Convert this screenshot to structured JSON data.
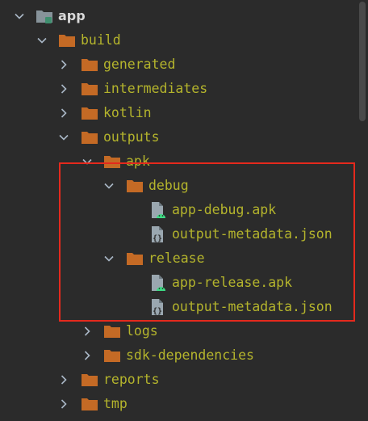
{
  "tree": {
    "root": {
      "label": "app",
      "icon": "module-folder-icon"
    },
    "build": {
      "label": "build"
    },
    "generated": {
      "label": "generated"
    },
    "intermediates": {
      "label": "intermediates"
    },
    "kotlin": {
      "label": "kotlin"
    },
    "outputs": {
      "label": "outputs"
    },
    "apk": {
      "label": "apk"
    },
    "debug": {
      "label": "debug"
    },
    "debug_apk": {
      "label": "app-debug.apk",
      "icon": "android-apk-icon"
    },
    "debug_meta": {
      "label": "output-metadata.json",
      "icon": "json-file-icon"
    },
    "release": {
      "label": "release"
    },
    "release_apk": {
      "label": "app-release.apk",
      "icon": "android-apk-icon"
    },
    "release_meta": {
      "label": "output-metadata.json",
      "icon": "json-file-icon"
    },
    "logs": {
      "label": "logs"
    },
    "sdk_dependencies": {
      "label": "sdk-dependencies"
    },
    "reports": {
      "label": "reports"
    },
    "tmp": {
      "label": "tmp"
    }
  },
  "colors": {
    "background": "#2b2b2b",
    "folder": "#c46a25",
    "excluded_text": "#b4b42c",
    "highlight_box": "#e5291d",
    "android_green": "#3ddc84"
  }
}
